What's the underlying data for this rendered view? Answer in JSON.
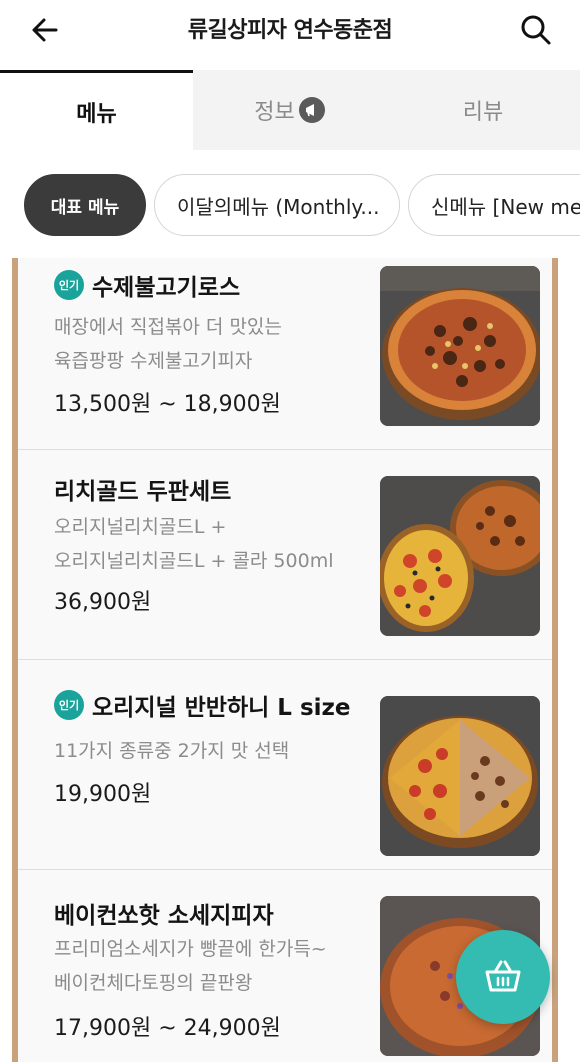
{
  "header": {
    "title": "류길상피자 연수동춘점",
    "back_icon": "arrow-left-icon",
    "search_icon": "search-icon"
  },
  "tabs": [
    {
      "label": "메뉴",
      "active": true
    },
    {
      "label": "정보",
      "active": false,
      "icon": "megaphone-icon"
    },
    {
      "label": "리뷰",
      "active": false
    }
  ],
  "chips": [
    {
      "label": "대표 메뉴",
      "active": true
    },
    {
      "label": "이달의메뉴 (Monthly...",
      "active": false
    },
    {
      "label": "신메뉴 [New men",
      "active": false
    }
  ],
  "items": [
    {
      "badge": "인기",
      "name": "수제불고기로스",
      "desc1": "매장에서 직접볶아 더 맛있는",
      "desc2": "육즙팡팡 수제불고기피자",
      "price": "13,500원 ~ 18,900원"
    },
    {
      "badge": "",
      "name": "리치골드 두판세트",
      "desc1": "오리지널리치골드L +",
      "desc2": "오리지널리치골드L + 콜라 500ml",
      "price": "36,900원"
    },
    {
      "badge": "인기",
      "name": "오리지널 반반하니  L size",
      "desc1": "11가지 종류중 2가지 맛 선택",
      "desc2": "",
      "price": "19,900원"
    },
    {
      "badge": "",
      "name": "베이컨쏘핫 소세지피자",
      "desc1": "프리미엄소세지가 빵끝에 한가득~",
      "desc2": "베이컨체다토핑의 끝판왕",
      "price": "17,900원 ~ 24,900원"
    }
  ],
  "fab": {
    "icon": "shopping-basket-icon"
  },
  "colors": {
    "accent_teal": "#34bcb2",
    "badge_teal": "#1aa39a",
    "frame_tan": "#c9a27c",
    "chip_active": "#3b3b3b"
  }
}
